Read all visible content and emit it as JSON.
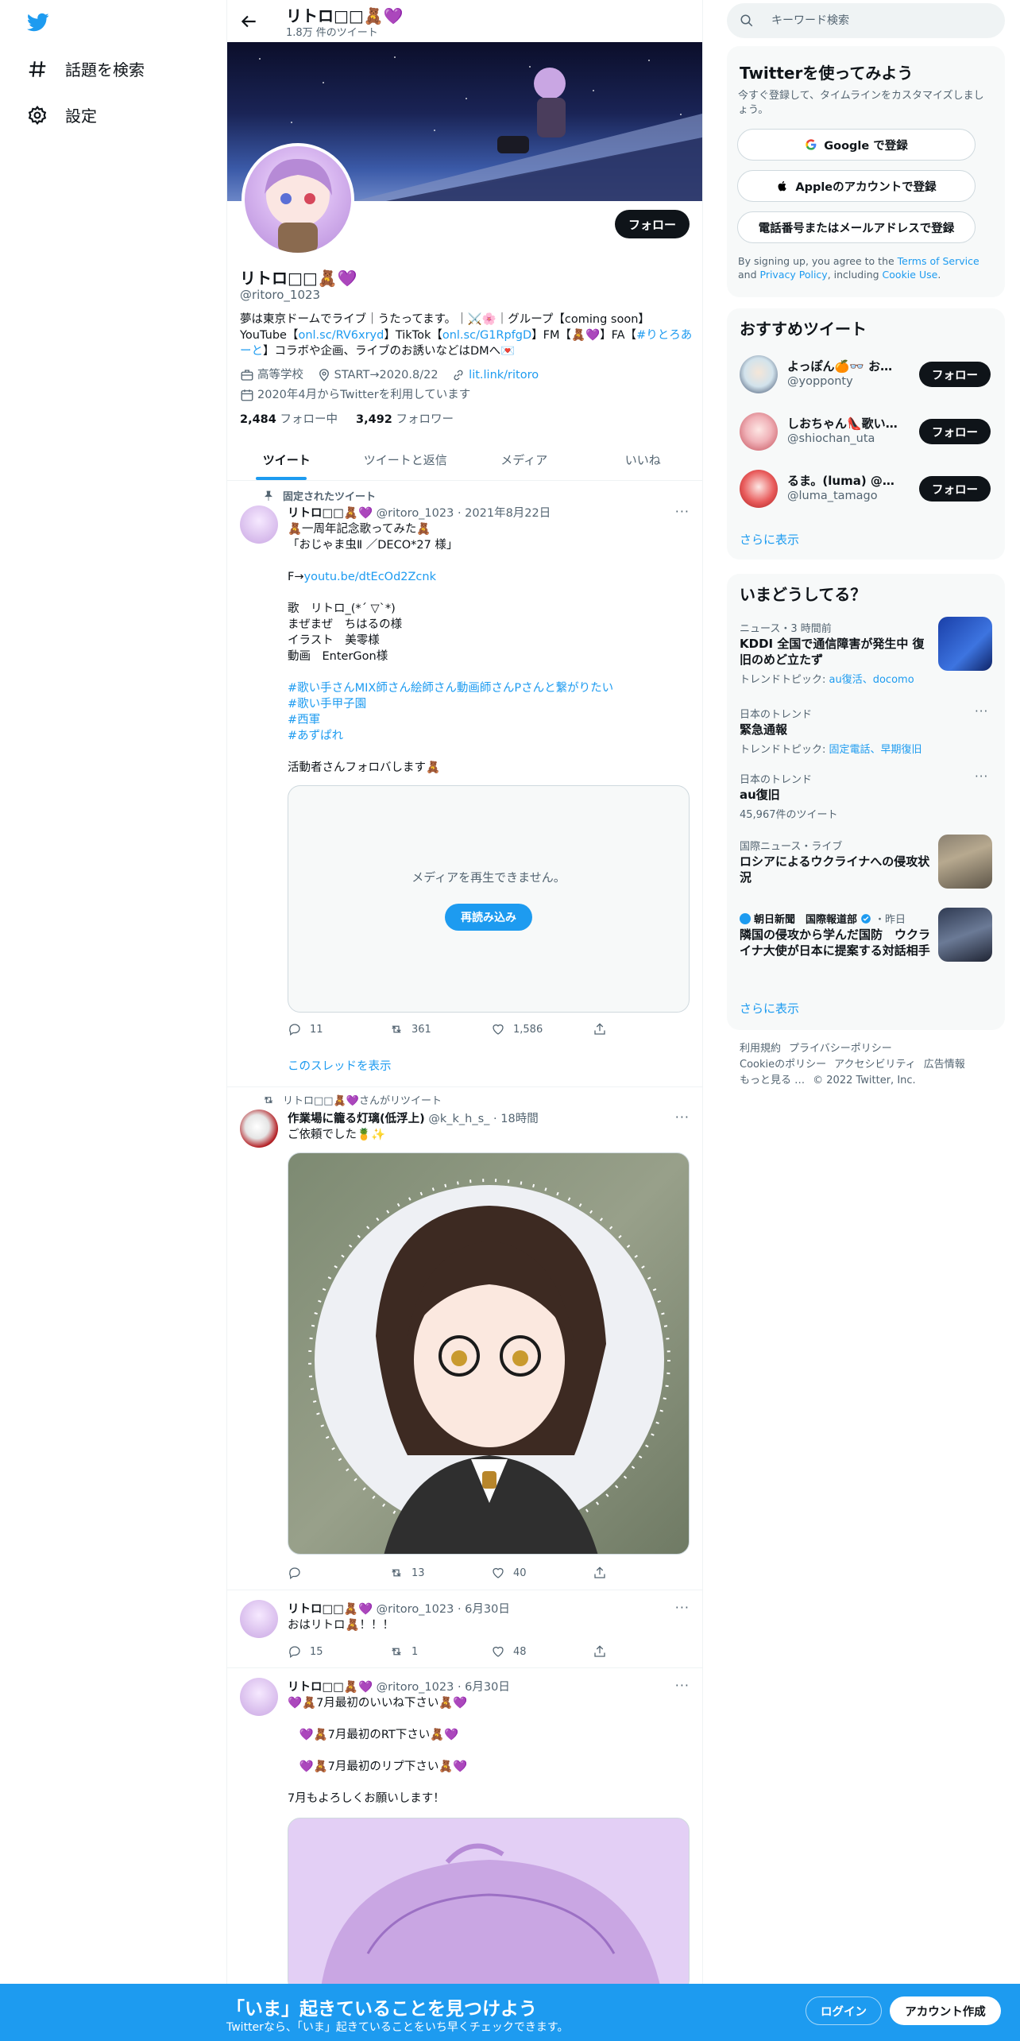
{
  "nav": {
    "logo_icon": "twitter-bird-icon",
    "items": [
      {
        "label": "話題を検索",
        "icon": "hashtag-icon"
      },
      {
        "label": "設定",
        "icon": "gear-icon"
      }
    ]
  },
  "header": {
    "name": "リトロ□□🧸💜",
    "tweet_count": "1.8万 件のツイート"
  },
  "profile": {
    "name": "リトロ□□🧸💜",
    "handle": "@ritoro_1023",
    "follow_label": "フォロー",
    "bio_1": "夢は東京ドームでライブ｜うたってます。｜⚔️🌸｜グループ【coming soon】",
    "bio_2a": "YouTube【",
    "bio_2b": "onl.sc/RV6xryd",
    "bio_2c": "】TikTok【",
    "bio_2d": "onl.sc/G1RpfgD",
    "bio_2e": "】FM【🧸💜】FA【",
    "bio_2f": "#りとろあーと",
    "bio_2g": "】コラボや企画、ライブのお誘いなどはDMへ💌",
    "meta_category": "高等学校",
    "meta_location": "START→2020.8/22",
    "meta_link": "lit.link/ritoro",
    "meta_joined": "2020年4月からTwitterを利用しています",
    "following_count": "2,484",
    "following_label": "フォロー中",
    "followers_count": "3,492",
    "followers_label": "フォロワー"
  },
  "tabs": [
    "ツイート",
    "ツイートと返信",
    "メディア",
    "いいね"
  ],
  "tweets": [
    {
      "context": "固定されたツイート",
      "name": "リトロ□□🧸💜",
      "handle": "@ritoro_1023",
      "time": "2021年8月22日",
      "text_1": "🧸一周年記念歌ってみた🧸\n「おじゃま虫Ⅱ ／DECO*27 様」\n\nF→",
      "link": "youtu.be/dtEcOd2Zcnk",
      "text_2": "\n\n歌　リトロ_(*ˊ ▽ˋ*)\nまぜまぜ　ちはるの様\nイラスト　美零様\n動画　EnterGon様\n\n",
      "hashtags": "#歌い手さんMIX師さん絵師さん動画師さんPさんと繋がりたい\n#歌い手甲子園\n#西軍\n#あずぱれ",
      "text_3": "\n\n活動者さんフォロバします🧸",
      "media_message": "メディアを再生できません。",
      "reload_label": "再読み込み",
      "replies": "11",
      "retweets": "361",
      "likes": "1,586",
      "thread_label": "このスレッドを表示"
    },
    {
      "context": "リトロ□□🧸💜さんがリツイート",
      "name": "作業場に籠る灯璃(低浮上)",
      "handle": "@k_k_h_s_",
      "time": "18時間",
      "text": "ご依頼でした🍍✨",
      "replies": "",
      "retweets": "13",
      "likes": "40"
    },
    {
      "name": "リトロ□□🧸💜",
      "handle": "@ritoro_1023",
      "time": "6月30日",
      "text": "おはリトロ🧸！！！",
      "replies": "15",
      "retweets": "1",
      "likes": "48"
    },
    {
      "name": "リトロ□□🧸💜",
      "handle": "@ritoro_1023",
      "time": "6月30日",
      "text": "💜🧸7月最初のいいね下さい🧸💜\n\n　💜🧸7月最初のRT下さい🧸💜\n\n　💜🧸7月最初のリプ下さい🧸💜\n\n7月もよろしくお願いします！"
    }
  ],
  "search": {
    "placeholder": "キーワード検索"
  },
  "signup": {
    "title": "Twitterを使ってみよう",
    "subtitle": "今すぐ登録して、タイムラインをカスタマイズしましょう。",
    "google": "Google で登録",
    "apple": "Appleのアカウントで登録",
    "phone": "電話番号またはメールアドレスで登録",
    "legal_1": "By signing up, you agree to the ",
    "terms": "Terms of Service",
    "legal_2": " and ",
    "privacy": "Privacy Policy",
    "legal_3": ", including ",
    "cookie": "Cookie Use",
    "legal_4": "."
  },
  "recommended": {
    "title": "おすすめツイート",
    "items": [
      {
        "name": "よっぽん🍊👓 おち…",
        "handle": "@yopponty",
        "button": "フォロー"
      },
      {
        "name": "しおちゃん👠歌い手…",
        "handle": "@shiochan_uta",
        "button": "フォロー"
      },
      {
        "name": "るま。(luma) @アメ…",
        "handle": "@luma_tamago",
        "button": "フォロー"
      }
    ],
    "show_more": "さらに表示"
  },
  "trends": {
    "title": "いまどうしてる？",
    "items": [
      {
        "meta": "ニュース・3 時間前",
        "title": "KDDI 全国で通信障害が発生中 復旧のめど立たず",
        "sub_label": "トレンドトピック: ",
        "sub_links": "au復活、docomo"
      },
      {
        "meta": "日本のトレンド",
        "title": "緊急通報",
        "sub_label": "トレンドトピック: ",
        "sub_links": "固定電話、早期復旧"
      },
      {
        "meta": "日本のトレンド",
        "title": "au復旧",
        "sub_label": "45,967件のツイート",
        "sub_links": ""
      },
      {
        "meta": "国際ニュース・ライブ",
        "title": "ロシアによるウクライナへの侵攻状況"
      },
      {
        "meta_source": "朝日新聞　国際報道部",
        "meta_time": "・昨日",
        "title": "隣国の侵攻から学んだ国防　ウクライナ大使が日本に提案する対話相手"
      }
    ],
    "show_more": "さらに表示"
  },
  "footer": {
    "links": [
      "利用規約",
      "プライバシーポリシー",
      "Cookieのポリシー",
      "アクセシビリティ",
      "広告情報",
      "もっと見る …",
      "© 2022 Twitter, Inc."
    ]
  },
  "bottombar": {
    "title": "「いま」起きていることを見つけよう",
    "subtitle": "Twitterなら、「いま」起きていることをいち早くチェックできます。",
    "login": "ログイン",
    "signup": "アカウント作成"
  },
  "colors": {
    "accent": "#1d9bf0",
    "text": "#0f1419",
    "muted": "#536471"
  }
}
